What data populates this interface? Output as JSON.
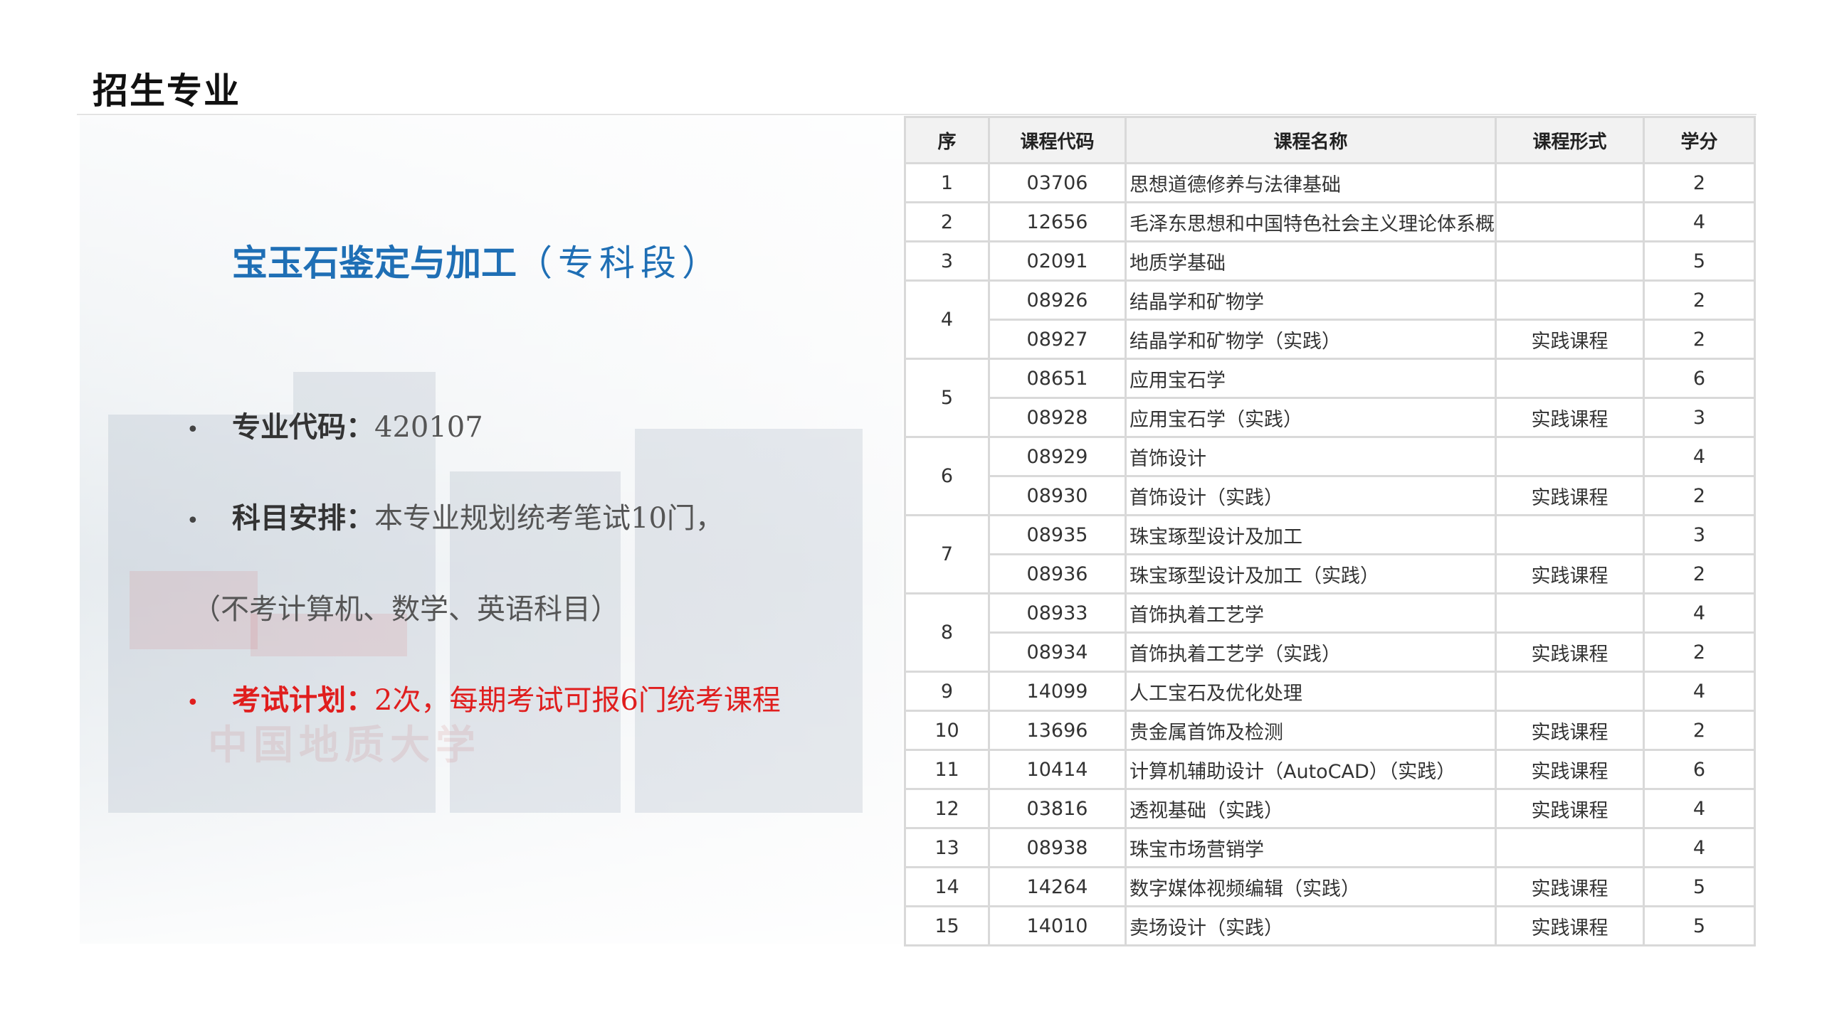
{
  "page_title": "招生专业",
  "major": {
    "name": "宝玉石鉴定与加工",
    "level": "（专科段）"
  },
  "info": {
    "code_label": "专业代码：",
    "code_value": "420107",
    "subjects_label": "科目安排：",
    "subjects_value": "本专业规划统考笔试10门，",
    "subjects_note": "（不考计算机、数学、英语科目）",
    "plan_label": "考试计划：",
    "plan_value": "2次，每期考试可报6门统考课程"
  },
  "bullet": "•",
  "campus_sign": "中国地质大学",
  "colors": {
    "major_title": "#1f6fb5",
    "plan_text": "#e01e1e",
    "table_border": "#d9d9d9",
    "header_bg": "#f2f2f2"
  },
  "table": {
    "headers": [
      "序",
      "课程代码",
      "课程名称",
      "课程形式",
      "学分"
    ],
    "groups": [
      {
        "seq": "1",
        "courses": [
          {
            "code": "03706",
            "name": "思想道德修养与法律基础",
            "form": "",
            "credit": "2"
          }
        ]
      },
      {
        "seq": "2",
        "courses": [
          {
            "code": "12656",
            "name": "毛泽东思想和中国特色社会主义理论体系概论",
            "form": "",
            "credit": "4"
          }
        ]
      },
      {
        "seq": "3",
        "courses": [
          {
            "code": "02091",
            "name": "地质学基础",
            "form": "",
            "credit": "5"
          }
        ]
      },
      {
        "seq": "4",
        "courses": [
          {
            "code": "08926",
            "name": "结晶学和矿物学",
            "form": "",
            "credit": "2"
          },
          {
            "code": "08927",
            "name": "结晶学和矿物学（实践）",
            "form": "实践课程",
            "credit": "2"
          }
        ]
      },
      {
        "seq": "5",
        "courses": [
          {
            "code": "08651",
            "name": "应用宝石学",
            "form": "",
            "credit": "6"
          },
          {
            "code": "08928",
            "name": "应用宝石学（实践）",
            "form": "实践课程",
            "credit": "3"
          }
        ]
      },
      {
        "seq": "6",
        "courses": [
          {
            "code": "08929",
            "name": "首饰设计",
            "form": "",
            "credit": "4"
          },
          {
            "code": "08930",
            "name": "首饰设计（实践）",
            "form": "实践课程",
            "credit": "2"
          }
        ]
      },
      {
        "seq": "7",
        "courses": [
          {
            "code": "08935",
            "name": "珠宝琢型设计及加工",
            "form": "",
            "credit": "3"
          },
          {
            "code": "08936",
            "name": "珠宝琢型设计及加工（实践）",
            "form": "实践课程",
            "credit": "2"
          }
        ]
      },
      {
        "seq": "8",
        "courses": [
          {
            "code": "08933",
            "name": "首饰执着工艺学",
            "form": "",
            "credit": "4"
          },
          {
            "code": "08934",
            "name": "首饰执着工艺学（实践）",
            "form": "实践课程",
            "credit": "2"
          }
        ]
      },
      {
        "seq": "9",
        "courses": [
          {
            "code": "14099",
            "name": "人工宝石及优化处理",
            "form": "",
            "credit": "4"
          }
        ]
      },
      {
        "seq": "10",
        "courses": [
          {
            "code": "13696",
            "name": "贵金属首饰及检测",
            "form": "实践课程",
            "credit": "2"
          }
        ]
      },
      {
        "seq": "11",
        "courses": [
          {
            "code": "10414",
            "name": "计算机辅助设计（AutoCAD）（实践）",
            "form": "实践课程",
            "credit": "6"
          }
        ]
      },
      {
        "seq": "12",
        "courses": [
          {
            "code": "03816",
            "name": "透视基础（实践）",
            "form": "实践课程",
            "credit": "4"
          }
        ]
      },
      {
        "seq": "13",
        "courses": [
          {
            "code": "08938",
            "name": "珠宝市场营销学",
            "form": "",
            "credit": "4"
          }
        ]
      },
      {
        "seq": "14",
        "courses": [
          {
            "code": "14264",
            "name": "数字媒体视频编辑（实践）",
            "form": "实践课程",
            "credit": "5"
          }
        ]
      },
      {
        "seq": "15",
        "courses": [
          {
            "code": "14010",
            "name": "卖场设计（实践）",
            "form": "实践课程",
            "credit": "5"
          }
        ]
      }
    ]
  }
}
